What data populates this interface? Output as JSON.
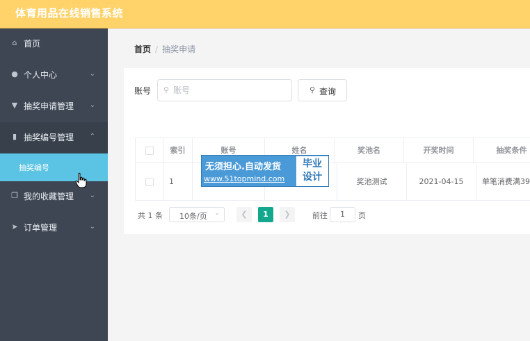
{
  "app": {
    "title": "体育用品在线销售系统"
  },
  "sidebar": {
    "items": [
      {
        "label": "首页",
        "icon": "home-icon"
      },
      {
        "label": "个人中心",
        "icon": "user-icon"
      },
      {
        "label": "抽奖申请管理",
        "icon": "pin-icon"
      },
      {
        "label": "抽奖编号管理",
        "icon": "bar-chart-icon"
      },
      {
        "label": "我的收藏管理",
        "icon": "copy-icon"
      },
      {
        "label": "订单管理",
        "icon": "send-icon"
      }
    ],
    "sub_item": {
      "label": "抽奖编号"
    }
  },
  "breadcrumb": {
    "home": "首页",
    "separator": "/",
    "current": "抽奖申请"
  },
  "search": {
    "label": "账号",
    "placeholder": "账号",
    "button_label": "查询"
  },
  "table": {
    "headers": [
      "索引",
      "账号",
      "姓名",
      "奖池名",
      "开奖时间",
      "抽奖条件"
    ],
    "rows": [
      {
        "index": "1",
        "account": "",
        "name": "",
        "pool": "奖池测试",
        "draw_time": "2021-04-15",
        "condition": "单笔消费满39"
      }
    ]
  },
  "pagination": {
    "total": "共 1 条",
    "page_size": "10条/页",
    "current_page": "1",
    "goto_label": "前往",
    "goto_value": "1",
    "page_suffix": "页"
  },
  "watermark": {
    "line1": "无须担心.自动发货",
    "line2": "www.51topmind.com",
    "line3a": "毕业",
    "line3b": "设计"
  },
  "colors": {
    "topbar": "#ffd36a",
    "sidebar": "#3d4652",
    "active_sub": "#5bc3e3",
    "page_active": "#13a88e"
  }
}
